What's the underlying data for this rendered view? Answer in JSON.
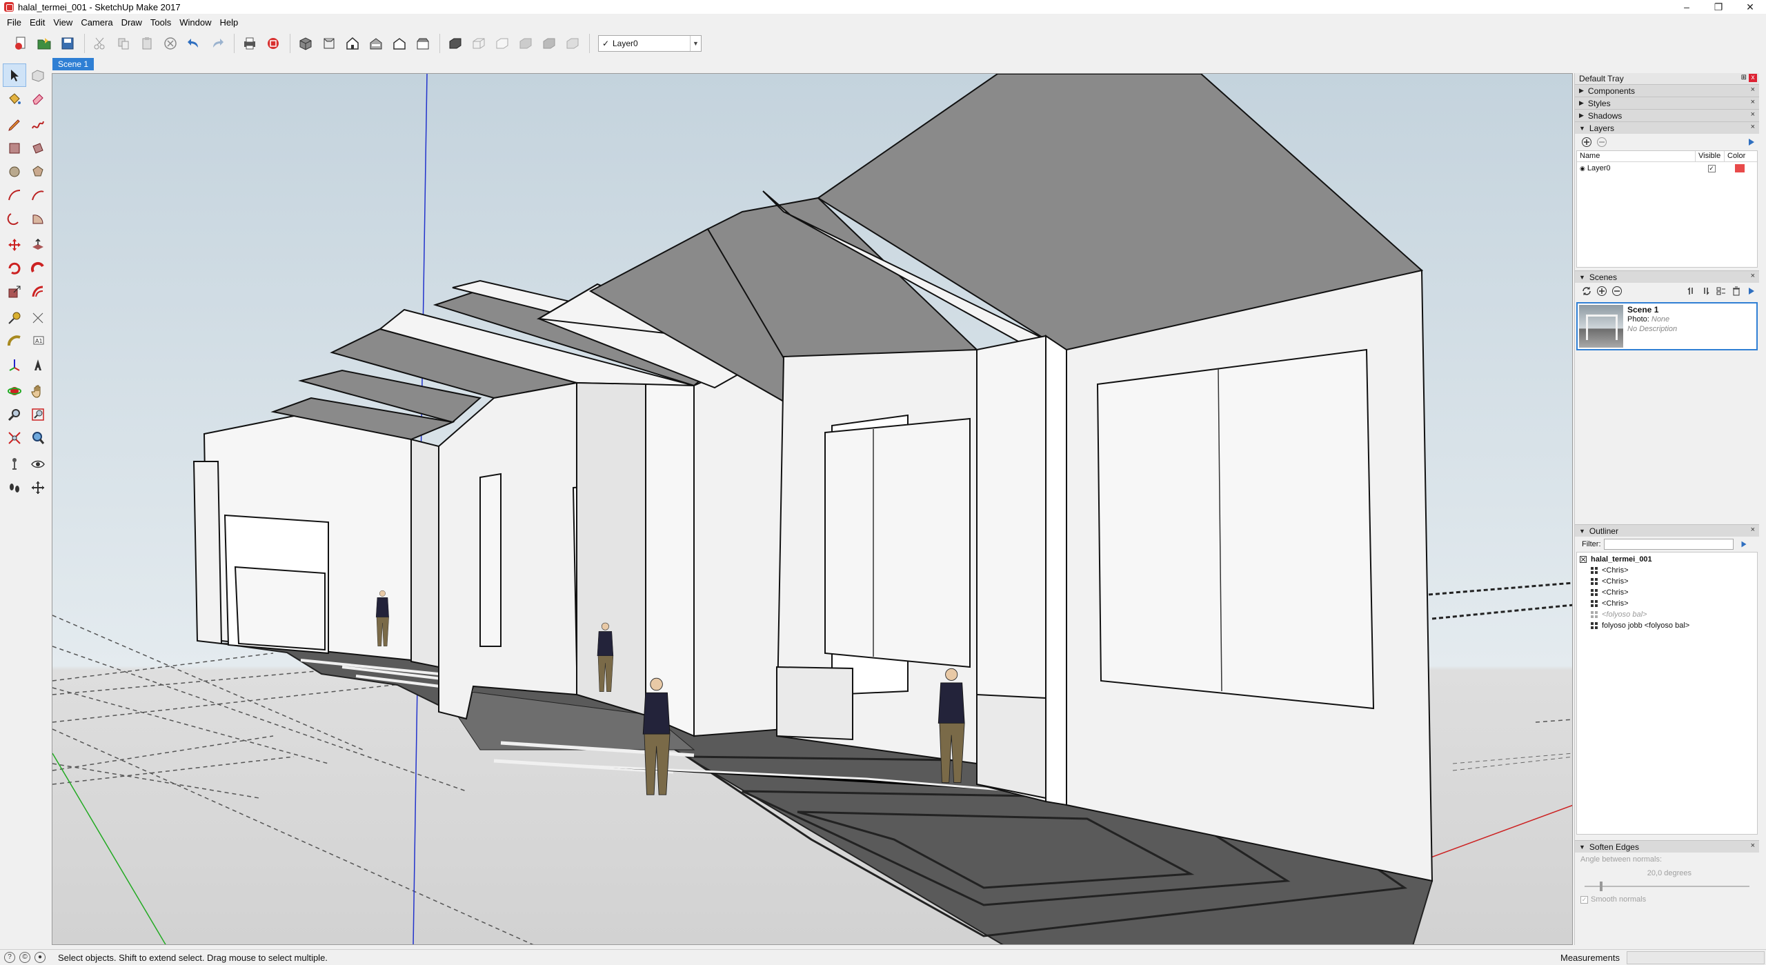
{
  "window": {
    "title": "halal_termei_001 - SketchUp Make 2017",
    "controls": [
      "–",
      "❐",
      "✕"
    ]
  },
  "menu": [
    "File",
    "Edit",
    "View",
    "Camera",
    "Draw",
    "Tools",
    "Window",
    "Help"
  ],
  "toolbar": {
    "layer_selected": "Layer0",
    "layer_check": "✓"
  },
  "scenes": {
    "tabs": [
      "Scene 1"
    ]
  },
  "tray": {
    "title": "Default Tray",
    "pin": "⊞",
    "close": "x",
    "panels": {
      "components": "Components",
      "styles": "Styles",
      "shadows": "Shadows",
      "layers": "Layers",
      "scenes": "Scenes",
      "outliner": "Outliner",
      "soften": "Soften Edges"
    },
    "layers": {
      "col_name": "Name",
      "col_visible": "Visible",
      "col_color": "Color",
      "rows": [
        {
          "name": "Layer0",
          "visible": "✓",
          "color": "#e84a4a"
        }
      ]
    },
    "scene_list": {
      "name": "Scene 1",
      "photo_label": "Photo:",
      "photo_value": "None",
      "description": "No Description"
    },
    "outliner": {
      "filter_label": "Filter:",
      "filter_value": "",
      "root": "halal_termei_001",
      "items": [
        {
          "label": "<Chris>",
          "hidden": false
        },
        {
          "label": "<Chris>",
          "hidden": false
        },
        {
          "label": "<Chris>",
          "hidden": false
        },
        {
          "label": "<Chris>",
          "hidden": false
        },
        {
          "label": "<folyoso bal>",
          "hidden": true
        },
        {
          "label": "folyoso jobb <folyoso bal>",
          "hidden": false
        }
      ]
    },
    "soften": {
      "angle_label": "Angle between normals:",
      "angle_value": "20,0  degrees",
      "smooth_label": "Smooth normals"
    }
  },
  "status": {
    "text": "Select objects. Shift to extend select. Drag mouse to select multiple.",
    "measurements_label": "Measurements",
    "measurements_value": ""
  },
  "colors": {
    "accent": "#2f7fd4",
    "roof": "#8a8a8a",
    "wall": "#f2f2f2",
    "floor": "#555555",
    "axis_blue": "#2233cc",
    "axis_green": "#22aa22",
    "axis_red": "#cc2222"
  }
}
